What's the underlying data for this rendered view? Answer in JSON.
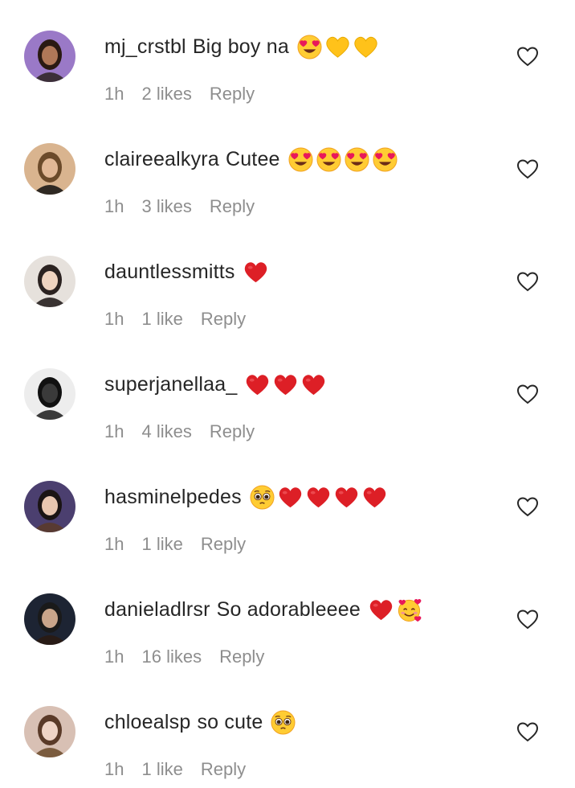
{
  "comments": [
    {
      "username": "mj_crstbl",
      "text": "Big boy na",
      "emojis": [
        "heart-eyes",
        "yellow-heart",
        "yellow-heart"
      ],
      "time": "1h",
      "likes": "2 likes",
      "reply": "Reply",
      "avatar_bg": "#9a79c7"
    },
    {
      "username": "claireealkyra",
      "text": "Cutee",
      "emojis": [
        "heart-eyes",
        "heart-eyes",
        "heart-eyes",
        "heart-eyes"
      ],
      "time": "1h",
      "likes": "3 likes",
      "reply": "Reply",
      "avatar_bg": "#d9b48f"
    },
    {
      "username": "dauntlessmitts",
      "text": "",
      "emojis": [
        "red-heart"
      ],
      "time": "1h",
      "likes": "1 like",
      "reply": "Reply",
      "avatar_bg": "#e6e1dc"
    },
    {
      "username": "superjanellaa_",
      "text": "",
      "emojis": [
        "red-heart",
        "red-heart",
        "red-heart"
      ],
      "time": "1h",
      "likes": "4 likes",
      "reply": "Reply",
      "avatar_bg": "#ededed"
    },
    {
      "username": "hasminelpedes",
      "text": "",
      "emojis": [
        "pleading-face",
        "red-heart",
        "red-heart",
        "red-heart",
        "red-heart"
      ],
      "time": "1h",
      "likes": "1 like",
      "reply": "Reply",
      "avatar_bg": "#4b3f6f"
    },
    {
      "username": "danieladlrsr",
      "text": "So adorableeee",
      "emojis": [
        "red-heart",
        "smiling-face-with-hearts"
      ],
      "time": "1h",
      "likes": "16 likes",
      "reply": "Reply",
      "avatar_bg": "#1d2433"
    },
    {
      "username": "chloealsp",
      "text": "so cute",
      "emojis": [
        "pleading-face"
      ],
      "time": "1h",
      "likes": "1 like",
      "reply": "Reply",
      "avatar_bg": "#d8c0b4"
    }
  ],
  "icons": {
    "like_button": "heart-outline-icon"
  },
  "colors": {
    "text": "#262626",
    "meta": "#8e8e8e",
    "background": "#ffffff"
  }
}
